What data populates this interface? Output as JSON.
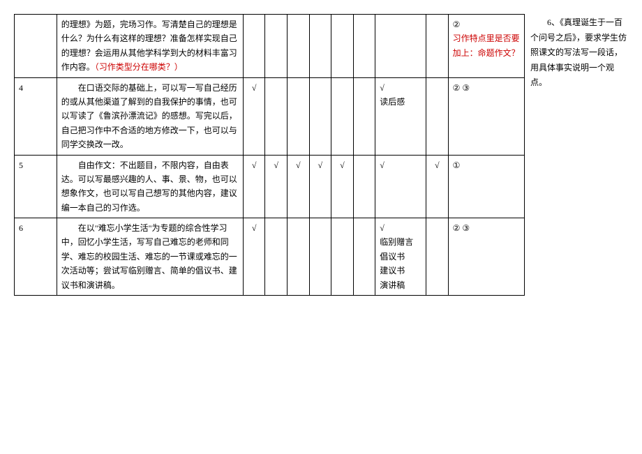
{
  "rows": [
    {
      "num": "",
      "content_parts": [
        {
          "text": "的理想》为题，完场习作。写清楚自己的理想是什么？为什么有这样的理想？准备怎样实现自己的理想？会运用从其他学科学到大的材料丰富习作内容。",
          "red": false,
          "indent": false
        },
        {
          "text": "（习作类型分在哪类？）",
          "red": true,
          "indent": false
        }
      ],
      "checks": [
        "",
        "",
        "",
        "",
        "",
        ""
      ],
      "type_col": "",
      "mid_col": "",
      "marks_parts": [
        {
          "text": "②",
          "red": false,
          "indent": false
        },
        {
          "text": "习作特点里是否要加上：命题作文？",
          "red": true,
          "indent": false
        }
      ]
    },
    {
      "num": "4",
      "content_parts": [
        {
          "text": "在口语交际的基础上，可以写一写自己经历的或从其他渠道了解到的自我保护的事情，也可以写读了《鲁滨孙漂流记》的感想。写完以后，自己把习作中不合适的地方修改一下，也可以与同学交换改一改。",
          "red": false,
          "indent": true
        }
      ],
      "checks": [
        "√",
        "",
        "",
        "",
        "",
        ""
      ],
      "type_col": "√\n读后感",
      "mid_col": "",
      "marks_parts": [
        {
          "text": "②  ③",
          "red": false,
          "indent": false
        }
      ]
    },
    {
      "num": "5",
      "content_parts": [
        {
          "text": "自由作文：不出题目，不限内容，自由表达。可以写最感兴趣的人、事、景、物，也可以想象作文，也可以写自己想写的其他内容，建议编一本自己的习作选。",
          "red": false,
          "indent": true
        }
      ],
      "checks": [
        "√",
        "√",
        "√",
        "√",
        "√",
        ""
      ],
      "type_col": "√",
      "mid_col": "√",
      "marks_parts": [
        {
          "text": "①",
          "red": false,
          "indent": false
        }
      ]
    },
    {
      "num": "6",
      "content_parts": [
        {
          "text": "在以\"难忘小学生活\"为专题的综合性学习中，回忆小学生活，写写自己难忘的老师和同学、难忘的校园生活、难忘的一节课或难忘的一次活动等；尝试写临别赠言、简单的倡议书、建议书和演讲稿。",
          "red": false,
          "indent": true
        }
      ],
      "checks": [
        "√",
        "",
        "",
        "",
        "",
        ""
      ],
      "type_col": "√\n临别赠言\n倡议书\n建议书\n演讲稿",
      "mid_col": "",
      "marks_parts": [
        {
          "text": "②  ③",
          "red": false,
          "indent": false
        }
      ]
    }
  ],
  "side_note": "6、《真理诞生于一百个问号之后》，要求学生仿照课文的写法写一段话，用具体事实说明一个观点。"
}
